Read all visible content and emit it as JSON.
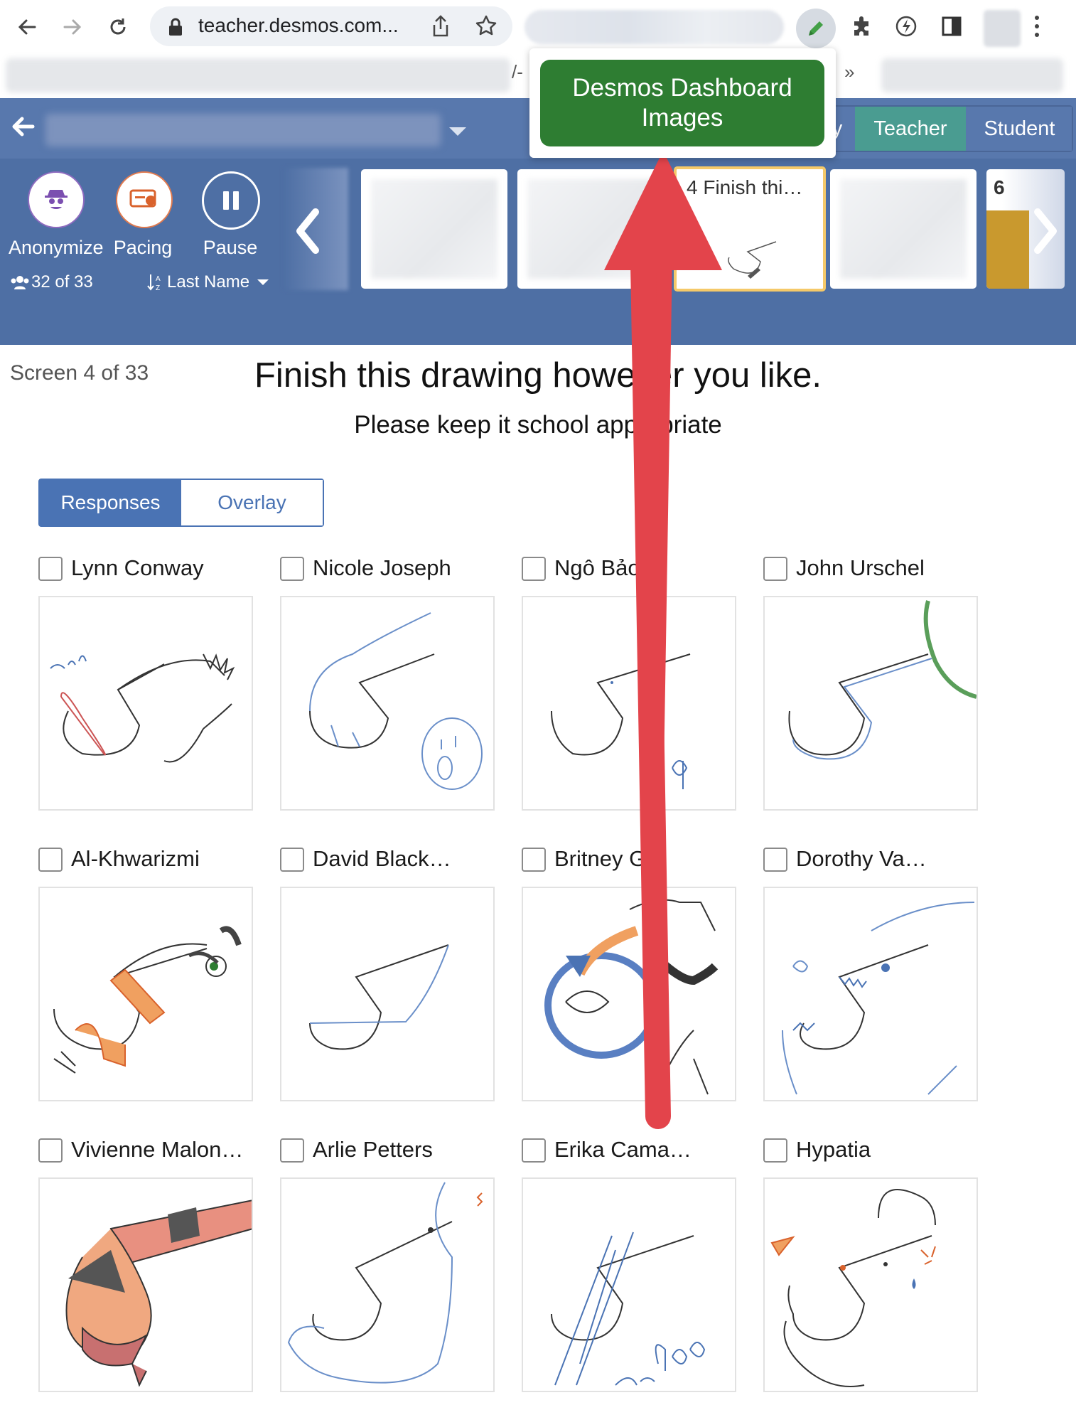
{
  "browser": {
    "url": "teacher.desmos.com...",
    "bookmark_overflow": "»",
    "bookmark_fragment": "/-"
  },
  "popup": {
    "button_line1": "Desmos Dashboard",
    "button_line2": "Images"
  },
  "header": {
    "mode_partial": "y",
    "mode_teacher": "Teacher",
    "mode_student": "Student",
    "accent_color": "#4a9c91"
  },
  "controls": {
    "anonymize_label": "Anonymize",
    "pacing_label": "Pacing",
    "pause_label": "Pause",
    "student_count": "32 of 33",
    "sort_label": "Last Name",
    "thumb4_title": "4 Finish thi…",
    "thumb6_title": "6"
  },
  "content": {
    "screen_label": "Screen 4 of 33",
    "prompt_title": "Finish this drawing however you like.",
    "prompt_subtitle": "Please keep it school appropriate",
    "tab_responses": "Responses",
    "tab_overlay": "Overlay"
  },
  "students": [
    {
      "name": "Lynn Conway"
    },
    {
      "name": "Nicole Joseph"
    },
    {
      "name": "Ngô Bảo ..."
    },
    {
      "name": "John Urschel"
    },
    {
      "name": "Al-Khwarizmi"
    },
    {
      "name": "David Black…"
    },
    {
      "name": "Britney G…"
    },
    {
      "name": "Dorothy Va…"
    },
    {
      "name": "Vivienne Malon…"
    },
    {
      "name": "Arlie Petters"
    },
    {
      "name": "Erika Cama…"
    },
    {
      "name": "Hypatia"
    }
  ]
}
